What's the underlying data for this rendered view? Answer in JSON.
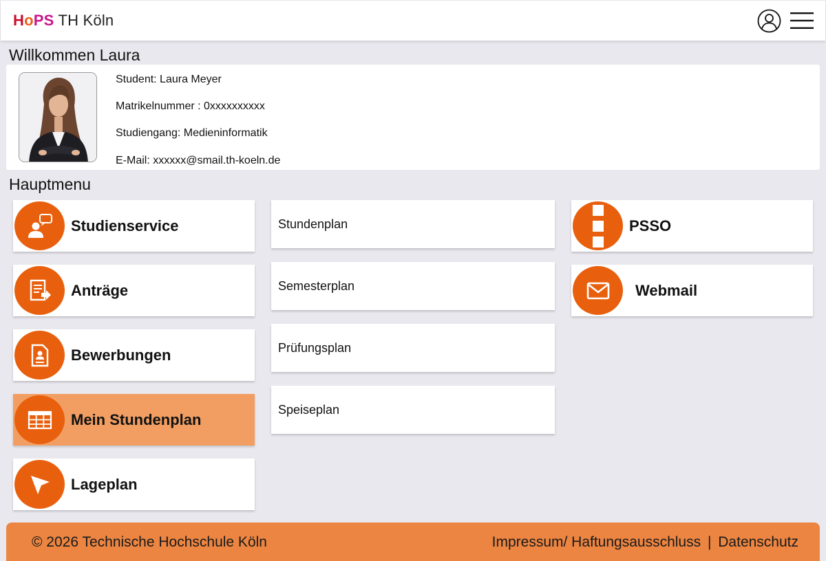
{
  "app": {
    "logo_h": "H",
    "logo_o": "o",
    "logo_ps": "PS",
    "logo_suffix": "TH Köln"
  },
  "welcome": "Willkommen Laura",
  "student": {
    "name_line": "Student: Laura Meyer",
    "matrikel_line": "Matrikelnummer : 0xxxxxxxxxx",
    "studiengang_line": "Studiengang: Medieninformatik",
    "email_line": "E-Mail: xxxxxx@smail.th-koeln.de"
  },
  "section_title": "Hauptmenu",
  "menu_left": [
    {
      "label": "Studienservice",
      "icon": "studienservice-icon"
    },
    {
      "label": "Anträge",
      "icon": "antraege-icon"
    },
    {
      "label": "Bewerbungen",
      "icon": "bewerbungen-icon"
    },
    {
      "label": "Mein Stundenplan",
      "icon": "calendar-grid-icon"
    },
    {
      "label": "Lageplan",
      "icon": "location-pointer-icon"
    }
  ],
  "menu_middle": [
    {
      "label": "Stundenplan"
    },
    {
      "label": "Semesterplan"
    },
    {
      "label": "Prüfungsplan"
    },
    {
      "label": "Speiseplan"
    }
  ],
  "menu_right": [
    {
      "label": "PSSO",
      "icon": "psso-icon"
    },
    {
      "label": "Webmail",
      "icon": "mail-icon"
    }
  ],
  "footer": {
    "copyright": "© 2026 Technische Hochschule Köln",
    "impressum": "Impressum/ Haftungsausschluss",
    "separator": "|",
    "datenschutz": "Datenschutz"
  },
  "colors": {
    "accent": "#e8600e",
    "active_tile": "#f29e62",
    "footer": "#ec8541",
    "background": "#e9e8ee"
  }
}
